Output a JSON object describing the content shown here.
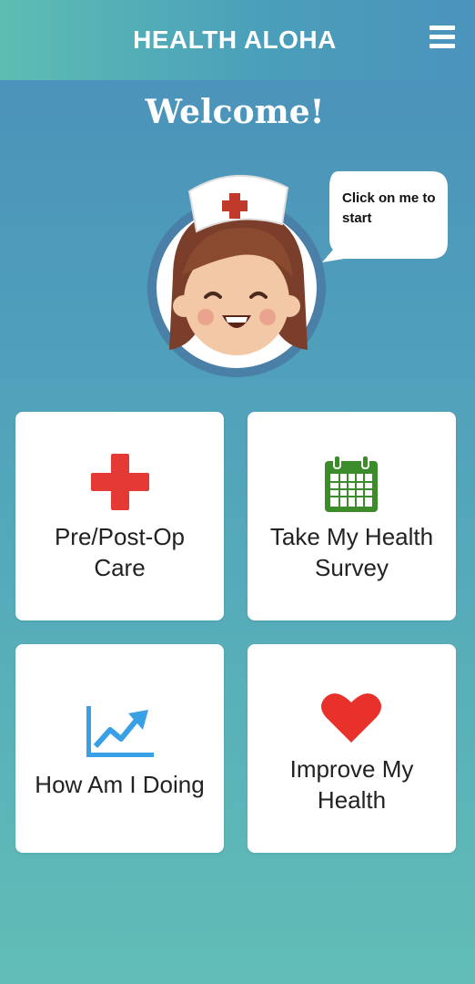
{
  "header": {
    "title": "HEALTH ALOHA",
    "menu_icon": "hamburger-menu-icon"
  },
  "welcome": {
    "title": "Welcome!",
    "bubble_text": "Click on me to start"
  },
  "cards": [
    {
      "label_line1": "Pre/Post-Op",
      "label_line2": "Care",
      "icon": "red-cross-icon",
      "icon_color": "#e53935"
    },
    {
      "label_line1": "Take My Health",
      "label_line2": "Survey",
      "icon": "calendar-icon",
      "icon_color": "#3c8c2c"
    },
    {
      "label_line1": "How Am I Doing",
      "icon": "trend-chart-icon",
      "icon_color": "#3aa0e6"
    },
    {
      "label_line1": "Improve My",
      "label_line2": "Health",
      "icon": "heart-icon",
      "icon_color": "#e8312b"
    }
  ],
  "colors": {
    "header_gradient_start": "#5dbdb3",
    "header_gradient_end": "#4b93bc",
    "background_top": "#4a8fba",
    "background_bottom": "#61bdb6"
  }
}
